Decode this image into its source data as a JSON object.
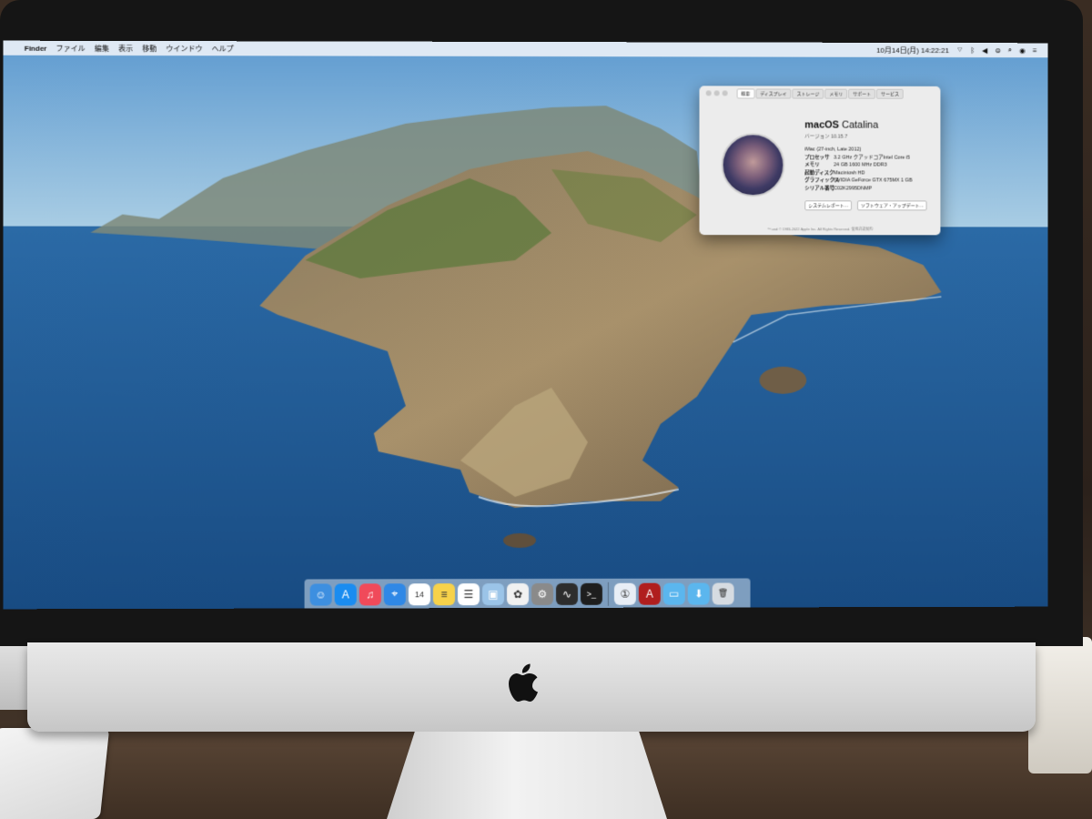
{
  "menubar": {
    "items": [
      "Finder",
      "ファイル",
      "編集",
      "表示",
      "移動",
      "ウインドウ",
      "ヘルプ"
    ],
    "clock": "10月14日(月) 14:22:21"
  },
  "about_window": {
    "tabs": [
      "概要",
      "ディスプレイ",
      "ストレージ",
      "メモリ",
      "サポート",
      "サービス"
    ],
    "os_name_light": "macOS",
    "os_name_regular": "Catalina",
    "version": "バージョン 10.15.7",
    "specs": [
      {
        "key": "",
        "value": "iMac (27-inch, Late 2012)"
      },
      {
        "key": "プロセッサ",
        "value": "3.2 GHz クアッドコアIntel Core i5"
      },
      {
        "key": "メモリ",
        "value": "24 GB 1600 MHz DDR3"
      },
      {
        "key": "起動ディスク",
        "value": "Macintosh HD"
      },
      {
        "key": "グラフィックス",
        "value": "NVIDIA GeForce GTX 675MX 1 GB"
      },
      {
        "key": "シリアル番号",
        "value": "C02K2995DNMP"
      }
    ],
    "buttons": [
      "システムレポート...",
      "ソフトウェア・アップデート..."
    ],
    "copyright": "™ and © 1983-2022 Apple Inc. All Rights Reserved. 使用許諾契約"
  },
  "dock": {
    "apps": [
      {
        "name": "finder-icon",
        "color": "#3d8fe0",
        "glyph": "☺"
      },
      {
        "name": "app-store-icon",
        "color": "#1a8cf0",
        "glyph": "A"
      },
      {
        "name": "music-icon",
        "color": "#f04a5a",
        "glyph": "♫"
      },
      {
        "name": "safari-icon",
        "color": "#2f88e6",
        "glyph": "⌖"
      },
      {
        "name": "calendar-icon",
        "color": "#ffffff",
        "glyph": "14"
      },
      {
        "name": "notes-icon",
        "color": "#f7d24a",
        "glyph": "≡"
      },
      {
        "name": "reminders-icon",
        "color": "#ffffff",
        "glyph": "☰"
      },
      {
        "name": "preview-icon",
        "color": "#9bc4e8",
        "glyph": "▣"
      },
      {
        "name": "photos-icon",
        "color": "#f1f1f1",
        "glyph": "✿"
      },
      {
        "name": "system-preferences-icon",
        "color": "#8a8a8a",
        "glyph": "⚙"
      },
      {
        "name": "activity-monitor-icon",
        "color": "#2d2d2d",
        "glyph": "∿"
      },
      {
        "name": "terminal-icon",
        "color": "#1e1e1e",
        "glyph": ">_"
      },
      {
        "name": "1password-icon",
        "color": "#e8eef6",
        "glyph": "①"
      },
      {
        "name": "acrobat-icon",
        "color": "#b01e1e",
        "glyph": "A"
      },
      {
        "name": "folder-icon",
        "color": "#5bb6ee",
        "glyph": "▭"
      },
      {
        "name": "downloads-folder-icon",
        "color": "#5bb6ee",
        "glyph": "⬇"
      },
      {
        "name": "trash-icon",
        "color": "#d6dbe1",
        "glyph": "🗑"
      }
    ]
  }
}
